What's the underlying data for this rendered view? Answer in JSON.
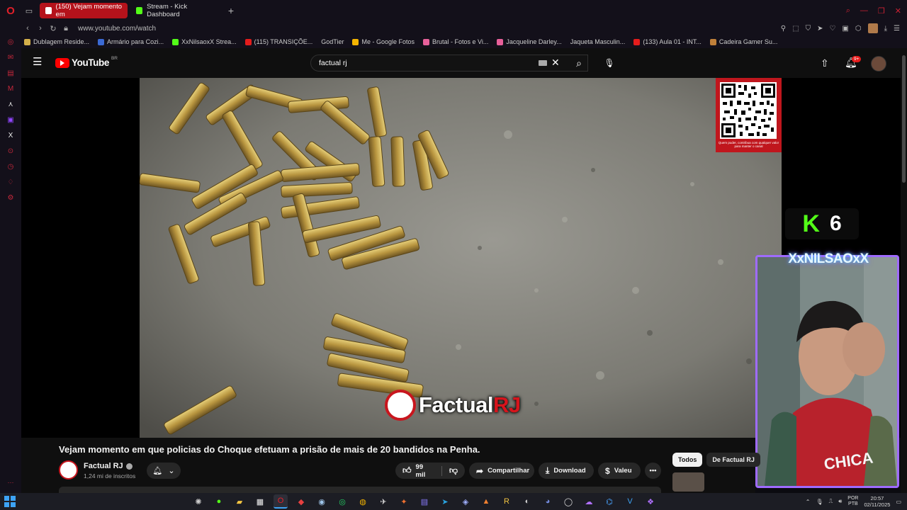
{
  "browser": {
    "tabs": [
      {
        "label": "(150) Vejam momento em",
        "active": true,
        "icon": "youtube-icon"
      },
      {
        "label": "Stream - Kick Dashboard",
        "active": false,
        "icon": "kick-icon"
      }
    ],
    "url": "www.youtube.com/watch",
    "bookmarks": [
      {
        "label": "Dublagem Reside...",
        "color": "#d4b04a"
      },
      {
        "label": "Armário para Cozi...",
        "color": "#3b6ad4"
      },
      {
        "label": "XxNilsaoxX Strea...",
        "color": "#53fc18"
      },
      {
        "label": "(115) TRANSIÇÕE...",
        "color": "#e41c1c"
      },
      {
        "label": "GodTier",
        "color": "#13101a"
      },
      {
        "label": "Me - Google Fotos",
        "color": "#f4b400"
      },
      {
        "label": "Brutal - Fotos e Vi...",
        "color": "#e8609a"
      },
      {
        "label": "Jacqueline Darley...",
        "color": "#e8609a"
      },
      {
        "label": "Jaqueta Masculin...",
        "color": "#13101a"
      },
      {
        "label": "(133) Aula 01 - INT...",
        "color": "#e41c1c"
      },
      {
        "label": "Cadeira Gamer Su...",
        "color": "#c0803a"
      }
    ]
  },
  "youtube": {
    "logo_text": "YouTube",
    "country_code": "BR",
    "search_value": "factual rj",
    "notif_count": "9+",
    "video": {
      "title": "Vejam momento em que policias do Choque efetuam a prisão de mais de 20 bandidos na Penha.",
      "watermark_main": "Factual",
      "watermark_accent": "RJ",
      "qr_caption": "Quem puder, contribua com qualquer valor para manter o canal"
    },
    "channel": {
      "name": "Factual RJ",
      "subscribers": "1,24 mi de inscritos"
    },
    "actions": {
      "likes": "99 mil",
      "share": "Compartilhar",
      "download": "Download",
      "thanks": "Valeu",
      "more": "•••"
    },
    "chips": [
      "Todos",
      "De Factual RJ"
    ]
  },
  "overlay": {
    "kick_logo": "K",
    "viewer_count": "6",
    "streamer_name": "XxNILSAOxX"
  },
  "taskbar": {
    "lang_line1": "POR",
    "lang_line2": "PTB",
    "time": "20:57",
    "date": "02/11/2025"
  }
}
